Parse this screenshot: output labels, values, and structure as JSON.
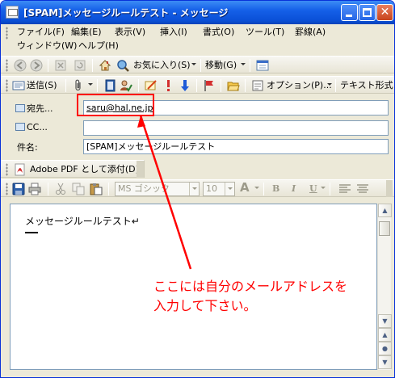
{
  "window": {
    "title": "[SPAM]メッセージルールテスト - メッセージ"
  },
  "menu": {
    "row1": [
      "ファイル(F)",
      "編集(E)",
      "表示(V)",
      "挿入(I)",
      "書式(O)",
      "ツール(T)",
      "罫線(A)"
    ],
    "row2": [
      "ウィンドウ(W)",
      "ヘルプ(H)"
    ]
  },
  "nav_toolbar": {
    "favorites_label": "お気に入り(S)",
    "go_label": "移動(G)"
  },
  "mail_toolbar": {
    "send_label": "送信(S)",
    "options_label": "オプション(P)...",
    "format_label": "テキスト形式"
  },
  "headers": {
    "to_label": "宛先...",
    "cc_label": "CC...",
    "subject_label": "件名:",
    "to_value": "saru@hal.ne.jp",
    "cc_value": "",
    "subject_value": "[SPAM]メッセージルールテスト"
  },
  "pdf_toolbar": {
    "label": "Adobe PDF として添付(D)"
  },
  "format_toolbar": {
    "font_name": "MS ゴシック",
    "font_size": "10",
    "font_color_label": "A",
    "bold_label": "B",
    "italic_label": "I",
    "underline_label": "U"
  },
  "editor": {
    "body_text": "メッセージルールテスト↵"
  },
  "annotation": {
    "line1": "ここには自分のメールアドレスを",
    "line2": "入力して下さい。",
    "color": "#ff0000"
  },
  "colors": {
    "titlebar": "#0a4fd6",
    "chrome": "#ece9d8",
    "field_border": "#7f9db9"
  }
}
